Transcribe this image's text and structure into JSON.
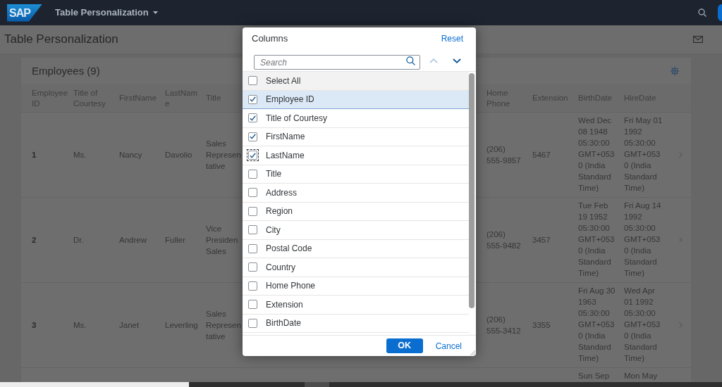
{
  "shell_bar": {
    "logo": "SAP",
    "title": "Table Personalization"
  },
  "page": {
    "title": "Table Personalization"
  },
  "table": {
    "title": "Employees (9)",
    "columns": [
      "Employee ID",
      "Title of Courtesy",
      "FirstName",
      "LastName",
      "Title",
      "Home Phone",
      "Extension",
      "BirthDate",
      "HireDate"
    ],
    "rows": [
      {
        "employee_id": "1",
        "title_of_courtesy": "Ms.",
        "first_name": "Nancy",
        "last_name": "Davolio",
        "title": "Sales\nRepresen\ntative",
        "home_phone": "(206) 555-9857",
        "extension": "5467",
        "birth_date": "Wed Dec 08 1948 05:30:00 GMT+0530 (India Standard Time)",
        "hire_date": "Fri May 01 1992 05:30:00 GMT+0530 (India Standard Time)"
      },
      {
        "employee_id": "2",
        "title_of_courtesy": "Dr.",
        "first_name": "Andrew",
        "last_name": "Fuller",
        "title": "Vice\nPresiden\nSales",
        "home_phone": "(206) 555-9482",
        "extension": "3457",
        "birth_date": "Tue Feb 19 1952 05:30:00 GMT+0530 (India Standard Time)",
        "hire_date": "Fri Aug 14 1992 05:30:00 GMT+0530 (India Standard Time)"
      },
      {
        "employee_id": "3",
        "title_of_courtesy": "Ms.",
        "first_name": "Janet",
        "last_name": "Leverling",
        "title": "Sales\nRepresen\ntative",
        "home_phone": "(206) 555-3412",
        "extension": "3355",
        "birth_date": "Fri Aug 30 1963 05:30:00 GMT+0530 (India Standard Time)",
        "hire_date": "Wed Apr 01 1992 05:30:00 GMT+0530 (India Standard Time)"
      },
      {
        "birth_date": "Sun Sep",
        "hire_date": "Mon May"
      }
    ]
  },
  "dialog": {
    "title": "Columns",
    "reset": "Reset",
    "search": {
      "placeholder": "Search"
    },
    "move_up": {
      "disabled": true
    },
    "move_down": {
      "disabled": false
    },
    "select_all": {
      "label": "Select All",
      "checked": false
    },
    "items": [
      {
        "label": "Employee ID",
        "checked": true,
        "selected": true,
        "focused": false
      },
      {
        "label": "Title of Courtesy",
        "checked": true,
        "selected": false,
        "focused": false
      },
      {
        "label": "FirstName",
        "checked": true,
        "selected": false,
        "focused": false
      },
      {
        "label": "LastName",
        "checked": true,
        "selected": false,
        "focused": true
      },
      {
        "label": "Title",
        "checked": false,
        "selected": false,
        "focused": false
      },
      {
        "label": "Address",
        "checked": false,
        "selected": false,
        "focused": false
      },
      {
        "label": "Region",
        "checked": false,
        "selected": false,
        "focused": false
      },
      {
        "label": "City",
        "checked": false,
        "selected": false,
        "focused": false
      },
      {
        "label": "Postal Code",
        "checked": false,
        "selected": false,
        "focused": false
      },
      {
        "label": "Country",
        "checked": false,
        "selected": false,
        "focused": false
      },
      {
        "label": "Home Phone",
        "checked": false,
        "selected": false,
        "focused": false
      },
      {
        "label": "Extension",
        "checked": false,
        "selected": false,
        "focused": false
      },
      {
        "label": "BirthDate",
        "checked": false,
        "selected": false,
        "focused": false
      }
    ],
    "buttons": [
      {
        "label": "OK",
        "kind": "primary"
      },
      {
        "label": "Cancel",
        "kind": "transparent"
      }
    ]
  }
}
